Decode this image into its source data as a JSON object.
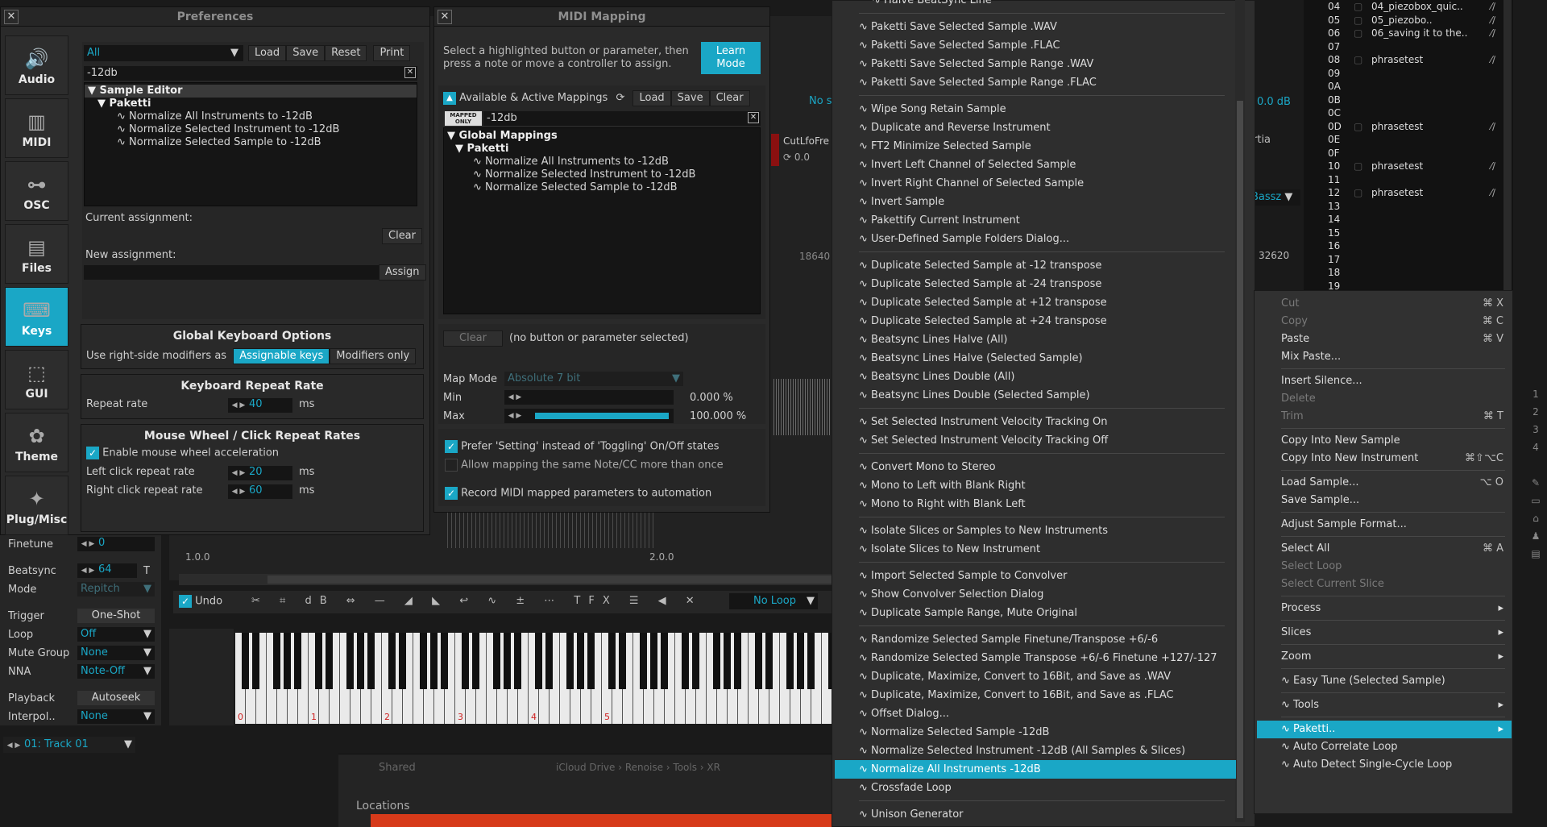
{
  "preferences": {
    "title": "Preferences",
    "tabs": [
      {
        "label": "Audio",
        "icon": "speaker-icon"
      },
      {
        "label": "MIDI",
        "icon": "piano-keys-icon"
      },
      {
        "label": "OSC",
        "icon": "network-icon"
      },
      {
        "label": "Files",
        "icon": "files-icon"
      },
      {
        "label": "Keys",
        "icon": "keyboard-key-icon"
      },
      {
        "label": "GUI",
        "icon": "gui-cursor-icon"
      },
      {
        "label": "Theme",
        "icon": "palette-icon"
      },
      {
        "label": "Plug/Misc",
        "icon": "puzzle-icon"
      }
    ],
    "selected_tab": "Keys",
    "filter_dropdown": "All",
    "buttons": {
      "load": "Load",
      "save": "Save",
      "reset": "Reset",
      "print": "Print"
    },
    "search_value": "-12db",
    "tree": {
      "root": "Sample Editor",
      "group": "Paketti",
      "items": [
        "Normalize All Instruments to -12dB",
        "Normalize Selected Instrument to -12dB",
        "Normalize Selected Sample to -12dB"
      ]
    },
    "current_assignment_label": "Current assignment:",
    "clear_label": "Clear",
    "new_assignment_label": "New assignment:",
    "assign_label": "Assign",
    "global_keyboard": {
      "title": "Global Keyboard Options",
      "modifiers_label": "Use right-side modifiers as",
      "option_a": "Assignable keys",
      "option_b": "Modifiers only"
    },
    "repeat_rate": {
      "title": "Keyboard Repeat Rate",
      "label": "Repeat rate",
      "value": "40",
      "unit": "ms"
    },
    "mouse_wheel": {
      "title": "Mouse Wheel / Click Repeat Rates",
      "accel_label": "Enable mouse wheel acceleration",
      "left_label": "Left click repeat rate",
      "left_value": "20",
      "right_label": "Right click repeat rate",
      "right_value": "60",
      "unit": "ms"
    }
  },
  "midi_mapping": {
    "title": "MIDI Mapping",
    "instructions": "Select a highlighted button or parameter, then press a note or move a controller to assign.",
    "learn_mode": "Learn Mode",
    "available_label": "Available & Active Mappings",
    "load": "Load",
    "save": "Save",
    "clear": "Clear",
    "mapped_only": "MAPPED ONLY",
    "search_value": "-12db",
    "tree": {
      "root": "Global Mappings",
      "group": "Paketti",
      "items": [
        "Normalize All Instruments to -12dB",
        "Normalize Selected Instrument to -12dB",
        "Normalize Selected Sample to -12dB"
      ]
    },
    "clear_btn": "Clear",
    "none_selected": "(no button or parameter selected)",
    "map_mode_label": "Map Mode",
    "map_mode_value": "Absolute 7 bit",
    "min_label": "Min",
    "min_value": "0.000 %",
    "max_label": "Max",
    "max_value": "100.000 %",
    "prefer_setting": "Prefer 'Setting' instead of 'Toggling' On/Off states",
    "allow_mapping": "Allow mapping the same Note/CC more than once",
    "record_midi": "Record MIDI mapped parameters to automation"
  },
  "sample_props": {
    "finetune_label": "Finetune",
    "finetune_value": "0",
    "beatsync_label": "Beatsync",
    "beatsync_value": "64",
    "beatsync_t": "T",
    "mode_label": "Mode",
    "mode_value": "Repitch",
    "trigger_label": "Trigger",
    "trigger_value": "One-Shot",
    "loop_label": "Loop",
    "loop_value": "Off",
    "mute_label": "Mute Group",
    "mute_value": "None",
    "nna_label": "NNA",
    "nna_value": "Note-Off",
    "playback_label": "Playback",
    "playback_value": "Autoseek",
    "interp_label": "Interpol..",
    "interp_value": "None",
    "track": "01: Track 01"
  },
  "editor": {
    "ruler_a": "1.0.0",
    "ruler_b": "2.0.0",
    "undo": "Undo",
    "no_loop": "No Loop",
    "counter_a": "18640",
    "counter_b": "32620",
    "cutlfo": "CutLfoFre",
    "cutlfo_value": "0.0",
    "db_value": "0.0 dB",
    "bassz": "Bassz",
    "ortia": "rtia",
    "no_s": "No s",
    "octaves": [
      "0",
      "1",
      "2",
      "3",
      "4",
      "5"
    ]
  },
  "pattern": {
    "rows": [
      {
        "n": "04",
        "name": "04_piezobox_quic.."
      },
      {
        "n": "05",
        "name": "05_piezobo.."
      },
      {
        "n": "06",
        "name": "06_saving it to the.."
      },
      {
        "n": "07",
        "name": ""
      },
      {
        "n": "08",
        "name": "phrasetest"
      },
      {
        "n": "09",
        "name": ""
      },
      {
        "n": "0A",
        "name": ""
      },
      {
        "n": "0B",
        "name": ""
      },
      {
        "n": "0C",
        "name": ""
      },
      {
        "n": "0D",
        "name": "phrasetest"
      },
      {
        "n": "0E",
        "name": ""
      },
      {
        "n": "0F",
        "name": ""
      },
      {
        "n": "10",
        "name": "phrasetest"
      },
      {
        "n": "11",
        "name": ""
      },
      {
        "n": "12",
        "name": "phrasetest"
      },
      {
        "n": "13",
        "name": ""
      },
      {
        "n": "14",
        "name": ""
      },
      {
        "n": "15",
        "name": ""
      },
      {
        "n": "16",
        "name": ""
      },
      {
        "n": "17",
        "name": ""
      },
      {
        "n": "18",
        "name": ""
      },
      {
        "n": "19",
        "name": ""
      }
    ]
  },
  "paketti_menu": {
    "top_cut": "Halve BeatSync Line",
    "groups": [
      [
        "Paketti Save Selected Sample .WAV",
        "Paketti Save Selected Sample .FLAC",
        "Paketti Save Selected Sample Range .WAV",
        "Paketti Save Selected Sample Range .FLAC"
      ],
      [
        "Wipe Song Retain Sample",
        "Duplicate and Reverse Instrument",
        "FT2 Minimize Selected Sample",
        "Invert Left Channel of Selected Sample",
        "Invert Right Channel of Selected Sample",
        "Invert Sample",
        "Pakettify Current Instrument",
        "User-Defined Sample Folders Dialog..."
      ],
      [
        "Duplicate Selected Sample at -12 transpose",
        "Duplicate Selected Sample at -24 transpose",
        "Duplicate Selected Sample at +12 transpose",
        "Duplicate Selected Sample at +24 transpose",
        "Beatsync Lines Halve (All)",
        "Beatsync Lines Halve (Selected Sample)",
        "Beatsync Lines Double (All)",
        "Beatsync Lines Double (Selected Sample)"
      ],
      [
        "Set Selected Instrument Velocity Tracking On",
        "Set Selected Instrument Velocity Tracking Off"
      ],
      [
        "Convert Mono to Stereo",
        "Mono to Left with Blank Right",
        "Mono to Right with Blank Left"
      ],
      [
        "Isolate Slices or Samples to New Instruments",
        "Isolate Slices to New Instrument"
      ],
      [
        "Import Selected Sample to Convolver",
        "Show Convolver Selection Dialog",
        "Duplicate Sample Range, Mute Original"
      ],
      [
        "Randomize Selected Sample Finetune/Transpose +6/-6",
        "Randomize Selected Sample Transpose +6/-6 Finetune +127/-127",
        "Duplicate, Maximize, Convert to 16Bit, and Save as .WAV",
        "Duplicate, Maximize, Convert to 16Bit, and Save as .FLAC",
        "Offset Dialog...",
        "Normalize Selected Sample -12dB",
        "Normalize Selected Instrument -12dB (All Samples & Slices)",
        "Normalize All Instruments -12dB",
        "Crossfade Loop"
      ],
      [
        "Unison Generator"
      ]
    ],
    "highlighted": "Normalize All Instruments -12dB"
  },
  "context_menu": {
    "items": [
      {
        "label": "Cut",
        "shortcut": "⌘ X",
        "disabled": true
      },
      {
        "label": "Copy",
        "shortcut": "⌘ C",
        "disabled": true
      },
      {
        "label": "Paste",
        "shortcut": "⌘ V"
      },
      {
        "label": "Mix Paste..."
      },
      {
        "sep": true
      },
      {
        "label": "Insert Silence..."
      },
      {
        "label": "Delete",
        "disabled": true
      },
      {
        "label": "Trim",
        "shortcut": "⌘ T",
        "disabled": true
      },
      {
        "sep": true
      },
      {
        "label": "Copy Into New Sample"
      },
      {
        "label": "Copy Into New Instrument",
        "shortcut": "⌘⇧⌥C"
      },
      {
        "sep": true
      },
      {
        "label": "Load Sample...",
        "shortcut": "⌥ O"
      },
      {
        "label": "Save Sample..."
      },
      {
        "sep": true
      },
      {
        "label": "Adjust Sample Format..."
      },
      {
        "sep": true
      },
      {
        "label": "Select All",
        "shortcut": "⌘ A"
      },
      {
        "label": "Select Loop",
        "disabled": true
      },
      {
        "label": "Select Current Slice",
        "disabled": true
      },
      {
        "sep": true
      },
      {
        "label": "Process",
        "submenu": true
      },
      {
        "sep": true
      },
      {
        "label": "Slices",
        "submenu": true
      },
      {
        "sep": true
      },
      {
        "label": "Zoom",
        "submenu": true
      },
      {
        "sep": true
      },
      {
        "label": "∿ Easy Tune (Selected Sample)"
      },
      {
        "sep": true
      },
      {
        "label": "∿ Tools",
        "submenu": true
      },
      {
        "sep": true
      },
      {
        "label": "∿ Paketti..",
        "submenu": true,
        "highlight": true
      },
      {
        "label": "∿ Auto Correlate Loop"
      },
      {
        "label": "∿ Auto Detect Single-Cycle Loop"
      }
    ]
  },
  "bottom": {
    "locations": "Locations",
    "shared": "Shared",
    "breadcrumbs": [
      "iCloud Drive",
      "Renoise",
      "Tools",
      "XR"
    ]
  }
}
